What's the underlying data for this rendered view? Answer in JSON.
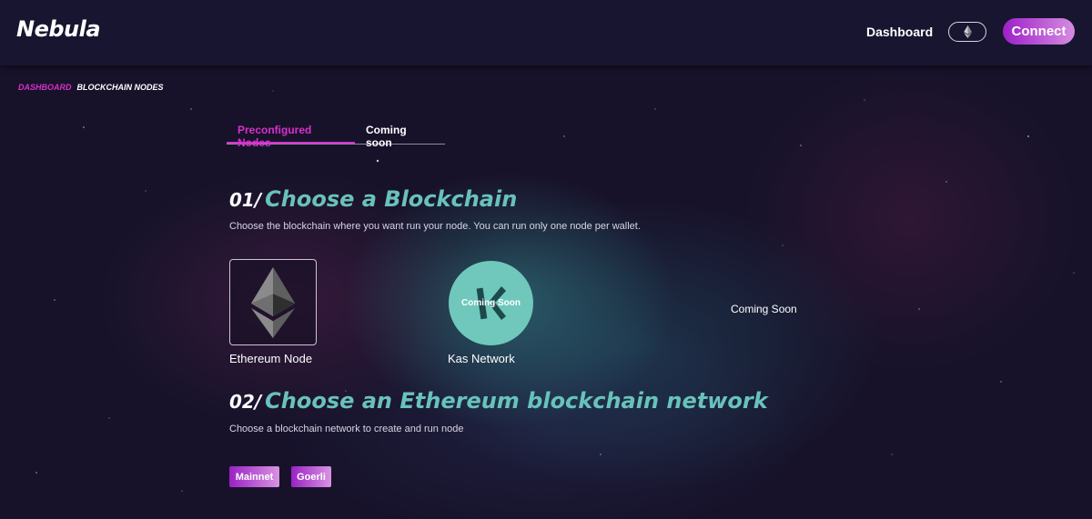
{
  "header": {
    "logo": "Nebula",
    "nav": {
      "dashboard": "Dashboard"
    },
    "network_icon": "ethereum-icon",
    "connect_label": "Connect"
  },
  "breadcrumb": {
    "items": [
      "DASHBOARD",
      "BLOCKCHAIN NODES"
    ]
  },
  "tabs": [
    {
      "label": "Preconfigured Nodes",
      "active": true
    },
    {
      "label": "Coming soon",
      "active": false
    }
  ],
  "step1": {
    "number": "01/",
    "title": "Choose a Blockchain",
    "description": "Choose the blockchain where you want run your node. You can run only one node per wallet."
  },
  "chains": [
    {
      "label": "Ethereum Node",
      "icon": "ethereum-icon",
      "selected": true
    },
    {
      "label": "Kas Network",
      "icon": "kas-logo-icon",
      "overlay": "Coming Soon"
    },
    {
      "label": "Coming Soon"
    }
  ],
  "step2": {
    "number": "02/",
    "title": "Choose an Ethereum blockchain network",
    "description": "Choose a blockchain network to create and run node"
  },
  "networks": [
    {
      "label": "Mainnet"
    },
    {
      "label": "Goerli"
    }
  ],
  "colors": {
    "accent_pink": "#d82fcf",
    "accent_teal": "#68c2bb",
    "button_gradient_start": "#9a22c4",
    "button_gradient_end": "#d894e2",
    "background": "#17122a"
  }
}
